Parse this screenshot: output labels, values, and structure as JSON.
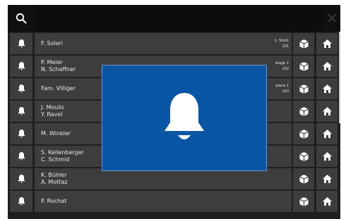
{
  "colors": {
    "screen_bg": "#1f1f1f",
    "cell_bg": "#3d3d3d",
    "topbar_bg": "#101010",
    "overlay_bg": "#0b55a5",
    "icon": "#ffffff"
  },
  "topbar": {
    "search_icon": "search-icon",
    "close_label": "✕"
  },
  "rows": [
    {
      "line1": "F. Solari",
      "line2": "",
      "floor1": "1. Stock",
      "floor2": "101"
    },
    {
      "line1": "P. Meier",
      "line2": "N. Schaffner",
      "floor1": "étage 1",
      "floor2": "102"
    },
    {
      "line1": "Fam. Villiger",
      "line2": "",
      "floor1": "piano 1",
      "floor2": "103"
    },
    {
      "line1": "J. Moulis",
      "line2": "Y. Ravel",
      "floor1": "",
      "floor2": ""
    },
    {
      "line1": "M. Winkler",
      "line2": "",
      "floor1": "",
      "floor2": ""
    },
    {
      "line1": "S. Kellenberger",
      "line2": "C. Schmid",
      "floor1": "",
      "floor2": ""
    },
    {
      "line1": "K. Bühler",
      "line2": "A. Mottaz",
      "floor1": "",
      "floor2": ""
    },
    {
      "line1": "P. Rochat",
      "line2": "",
      "floor1": "",
      "floor2": ""
    }
  ],
  "overlay": {
    "icon": "bell-icon"
  }
}
